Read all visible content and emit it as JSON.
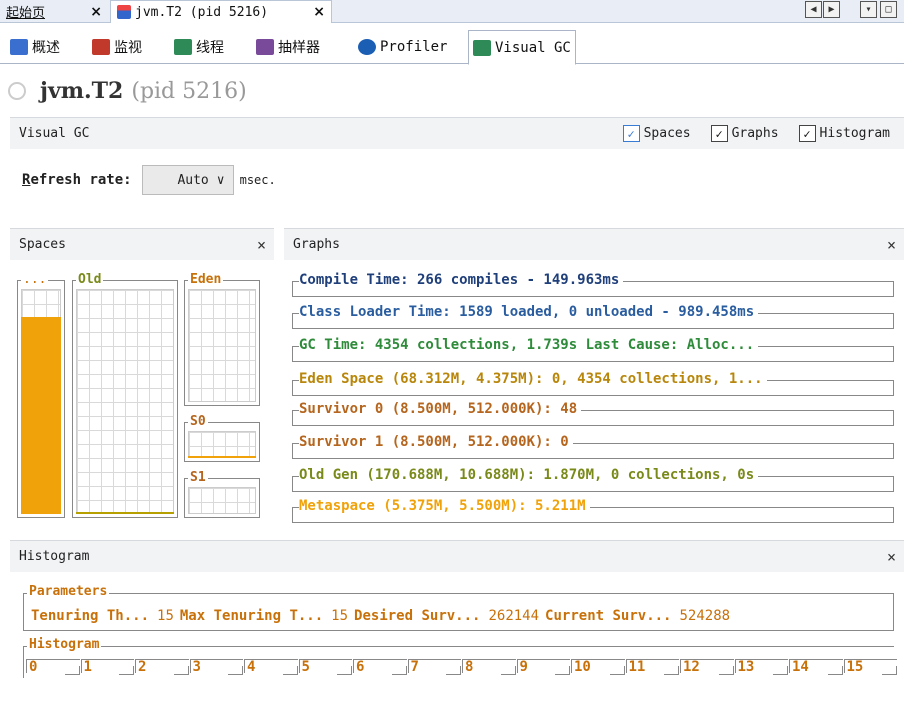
{
  "doc_tabs": [
    {
      "label": "起始页",
      "close": "×"
    },
    {
      "label": "jvm.T2 (pid 5216)",
      "close": "×"
    }
  ],
  "view_tabs": [
    {
      "label": "概述",
      "icon": "overview-icon",
      "color": "#3a6fd0"
    },
    {
      "label": "监视",
      "icon": "monitor-icon",
      "color": "#c0392b"
    },
    {
      "label": "线程",
      "icon": "threads-icon",
      "color": "#2e8b57"
    },
    {
      "label": "抽样器",
      "icon": "sampler-icon",
      "color": "#7a4a9a"
    },
    {
      "label": "Profiler",
      "icon": "profiler-icon",
      "color": "#1b5fb5"
    },
    {
      "label": "Visual GC",
      "icon": "visualgc-icon",
      "color": "#2e8b57"
    }
  ],
  "app": {
    "name": "jvm.T2",
    "pid": "(pid 5216)"
  },
  "visualgc_panel": {
    "title": "Visual GC",
    "checkboxes": [
      {
        "label": "Spaces",
        "checked": true
      },
      {
        "label": "Graphs",
        "checked": true
      },
      {
        "label": "Histogram",
        "checked": true
      }
    ]
  },
  "refresh": {
    "label_first": "R",
    "label_rest": "efresh rate:",
    "value": "Auto",
    "unit": "msec."
  },
  "spaces": {
    "title": "Spaces",
    "close": "×",
    "perm_label": "...",
    "old_label": "Old",
    "eden_label": "Eden",
    "s0_label": "S0",
    "s1_label": "S1",
    "perm_fill_fraction": 0.88
  },
  "graphs": {
    "title": "Graphs",
    "close": "×",
    "rows": [
      {
        "text": "Compile Time: 266 compiles - 149.963ms",
        "color": "#1f3f7a"
      },
      {
        "text": "Class Loader Time: 1589 loaded, 0 unloaded - 989.458ms",
        "color": "#2a5d9f"
      },
      {
        "text": "GC Time: 4354 collections, 1.739s  Last Cause: Alloc...",
        "color": "#2e8b3a"
      },
      {
        "text": "Eden Space (68.312M, 4.375M): 0, 4354 collections, 1...",
        "color": "#b8860b"
      },
      {
        "text": "Survivor 0 (8.500M, 512.000K): 48",
        "color": "#b5651d"
      },
      {
        "text": "Survivor 1 (8.500M, 512.000K): 0",
        "color": "#b5651d"
      },
      {
        "text": "Old Gen (170.688M, 10.688M): 1.870M, 0 collections, 0s",
        "color": "#7a8a1a"
      },
      {
        "text": "Metaspace (5.375M, 5.500M): 5.211M",
        "color": "#f0a20a"
      }
    ]
  },
  "histogram": {
    "title": "Histogram",
    "close": "×",
    "params_label": "Parameters",
    "params": [
      {
        "key": "Tenuring Th...",
        "value": "15"
      },
      {
        "key": "Max Tenuring T...",
        "value": "15"
      },
      {
        "key": "Desired Surv...",
        "value": "262144"
      },
      {
        "key": "Current Surv...",
        "value": "524288"
      }
    ],
    "hist_label": "Histogram",
    "bins": [
      "0",
      "1",
      "2",
      "3",
      "4",
      "5",
      "6",
      "7",
      "8",
      "9",
      "10",
      "11",
      "12",
      "13",
      "14",
      "15"
    ]
  }
}
